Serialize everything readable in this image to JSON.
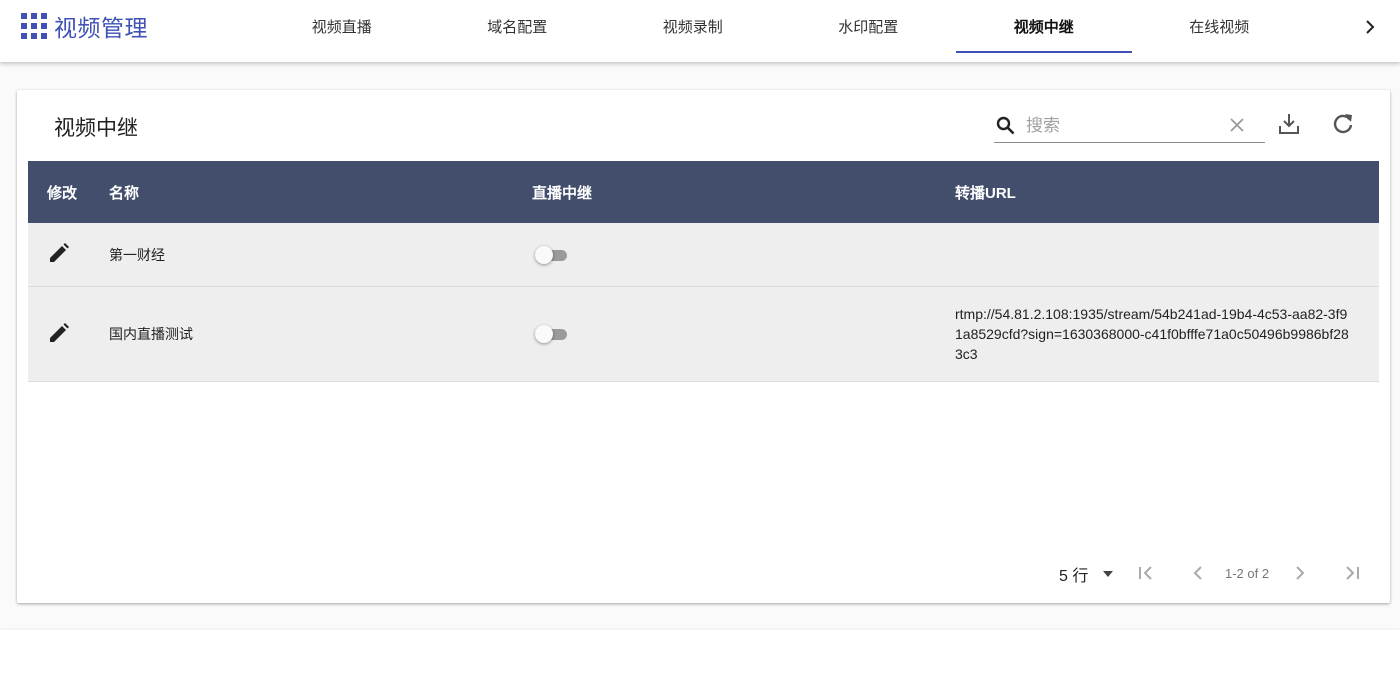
{
  "app": {
    "title": "视频管理",
    "icon": "apps-grid-icon"
  },
  "nav": {
    "tabs": [
      {
        "label": "视频直播"
      },
      {
        "label": "域名配置"
      },
      {
        "label": "视频录制"
      },
      {
        "label": "水印配置"
      },
      {
        "label": "视频中继",
        "active": true
      },
      {
        "label": "在线视频"
      }
    ],
    "next_icon": "chevron-right-icon"
  },
  "page": {
    "title": "视频中继",
    "search": {
      "placeholder": "搜索",
      "value": ""
    }
  },
  "table": {
    "columns": [
      "修改",
      "名称",
      "直播中继",
      "转播URL"
    ],
    "rows": [
      {
        "name": "第一财经",
        "relay_enabled": false,
        "url": ""
      },
      {
        "name": "国内直播测试",
        "relay_enabled": false,
        "url": "rtmp://54.81.2.108:1935/stream/54b241ad-19b4-4c53-aa82-3f91a8529cfd?sign=1630368000-c41f0bfffe71a0c50496b9986bf283c3"
      }
    ]
  },
  "pagination": {
    "rows_per_page": "5 行",
    "range_text": "1-2 of 2"
  },
  "colors": {
    "accent": "#3f51b5",
    "header_bg": "#424e6b",
    "row_bg": "#eeeeee"
  }
}
